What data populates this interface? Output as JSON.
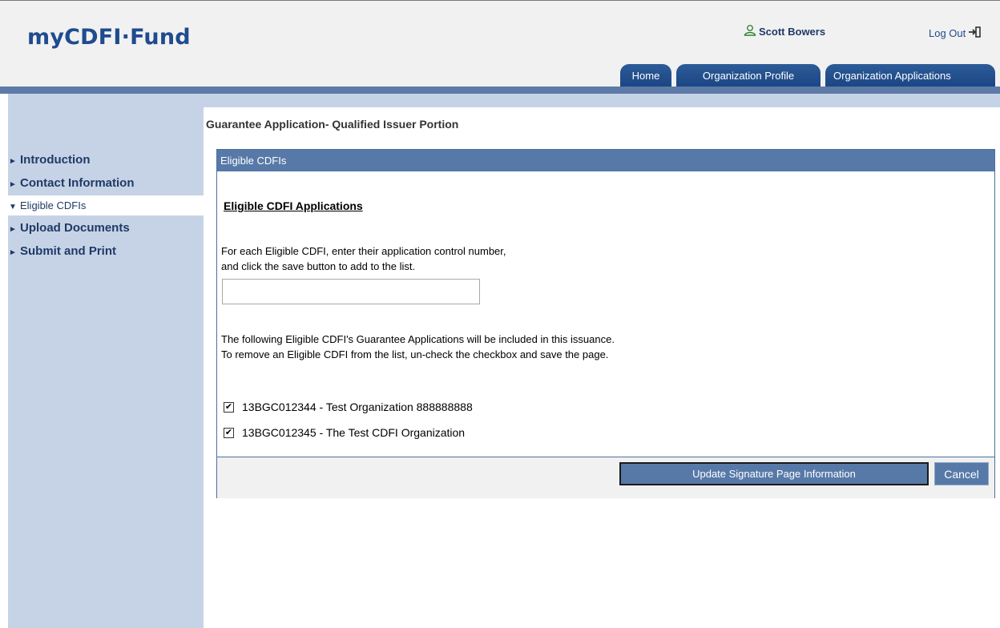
{
  "header": {
    "logo": "myCDFI·Fund",
    "user_name": "Scott Bowers",
    "user_icon": "person-icon",
    "logout_label": "Log Out",
    "logout_icon": "logout-icon",
    "tabs": [
      {
        "label": "Home"
      },
      {
        "label": "Organization Profile"
      },
      {
        "label": "Organization Applications"
      }
    ]
  },
  "sidebar": {
    "items": [
      {
        "label": "Introduction",
        "active": false
      },
      {
        "label": "Contact Information",
        "active": false
      },
      {
        "label": "Eligible CDFIs",
        "active": true
      },
      {
        "label": "Upload Documents",
        "active": false
      },
      {
        "label": "Submit and Print",
        "active": false
      }
    ]
  },
  "main": {
    "page_title": "Guarantee Application- Qualified Issuer Portion",
    "panel_title": "Eligible CDFIs",
    "section_heading": "Eligible CDFI Applications",
    "instruction_line1": "For each Eligible CDFI, enter their application control number,",
    "instruction_line2": "and click the save button to add to the list.",
    "control_number_value": "",
    "included_line1": "The following Eligible CDFI's Guarantee Applications will be included in this issuance.",
    "included_line2": "To remove an Eligible CDFI from the list, un-check the checkbox and save the page.",
    "cdfis": [
      {
        "label": "13BGC012344 - Test Organization 888888888",
        "checked": true
      },
      {
        "label": "13BGC012345 - The Test CDFI Organization",
        "checked": true
      }
    ],
    "update_button_label": "Update Signature Page Information",
    "cancel_button_label": "Cancel"
  },
  "colors": {
    "brand_blue": "#1f4b8f",
    "tab_blue": "#1b4583",
    "panel_blue": "#5779a8",
    "sidebar_bg": "#c6d3e6"
  }
}
